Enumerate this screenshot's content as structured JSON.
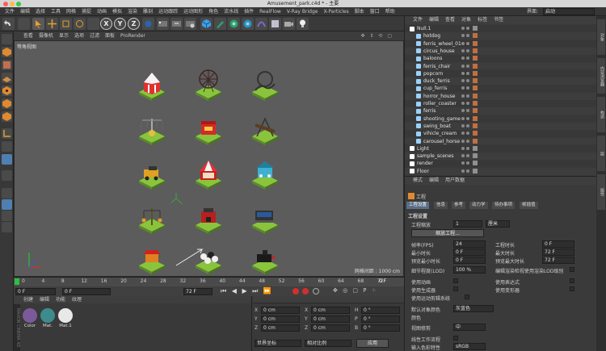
{
  "window": {
    "title": "Amusement_park.c4d * - 主要"
  },
  "menubar": {
    "items": [
      "文件",
      "编辑",
      "选择",
      "工具",
      "网格",
      "捕捉",
      "动画",
      "模拟",
      "渲染",
      "雕刻",
      "运动跟踪",
      "运动图形",
      "角色",
      "流水线",
      "插件",
      "RealFlow",
      "V-Ray Bridge",
      "X-Particles",
      "脚本",
      "窗口",
      "帮助"
    ],
    "interface_label": "界面:",
    "interface_value": "启动"
  },
  "viewport": {
    "menu": [
      "查看",
      "摄像机",
      "显示",
      "选项",
      "过滤",
      "面板",
      "ProRender"
    ],
    "label": "等角视图",
    "grid_info": "网格间距 : 1000 cm"
  },
  "timeline": {
    "ticks": [
      "0",
      "2",
      "4",
      "6",
      "8",
      "10",
      "12",
      "14",
      "16",
      "18",
      "20",
      "22",
      "24",
      "26",
      "28",
      "30",
      "32",
      "34",
      "36",
      "38",
      "40",
      "42",
      "44",
      "46",
      "48",
      "50",
      "52",
      "54",
      "56",
      "58",
      "60",
      "62",
      "64",
      "66",
      "68",
      "70",
      "72"
    ],
    "current": "0 F",
    "start": "0 F",
    "end": "72 F",
    "end2": "72 F",
    "frame_label": "0 F"
  },
  "materials": {
    "menu": [
      "创建",
      "编辑",
      "功能",
      "纹理"
    ],
    "items": [
      {
        "name": "Color",
        "color": "#7a5a9a"
      },
      {
        "name": "Mat.",
        "color": "#3c8c8e"
      },
      {
        "name": "Mat.1",
        "color": "#e8e8e8"
      }
    ]
  },
  "coordinates": {
    "rows": [
      {
        "axis": "X",
        "val": "0 cm",
        "axis2": "X",
        "val2": "0 cm",
        "axis3": "H",
        "val3": "0 °"
      },
      {
        "axis": "Y",
        "val": "0 cm",
        "axis2": "Y",
        "val2": "0 cm",
        "axis3": "P",
        "val3": "0 °"
      },
      {
        "axis": "Z",
        "val": "0 cm",
        "axis2": "Z",
        "val2": "0 cm",
        "axis3": "B",
        "val3": "0 °"
      }
    ],
    "mode": "世界坐标",
    "scale": "相对比例",
    "apply": "应用"
  },
  "objects": {
    "menu": [
      "文件",
      "编辑",
      "查看",
      "对象",
      "标签",
      "书签"
    ],
    "items": [
      {
        "name": "Null.1",
        "indent": 0,
        "color": "#ffffff"
      },
      {
        "name": "hotdog",
        "indent": 1,
        "color": "#9ad1ff"
      },
      {
        "name": "ferris_wheel_01",
        "indent": 1,
        "color": "#9ad1ff"
      },
      {
        "name": "circus_house",
        "indent": 1,
        "color": "#9ad1ff"
      },
      {
        "name": "baloons",
        "indent": 1,
        "color": "#9ad1ff"
      },
      {
        "name": "ferris_chair",
        "indent": 1,
        "color": "#9ad1ff"
      },
      {
        "name": "popcorn",
        "indent": 1,
        "color": "#9ad1ff"
      },
      {
        "name": "duck_ferris",
        "indent": 1,
        "color": "#9ad1ff"
      },
      {
        "name": "cup_ferris",
        "indent": 1,
        "color": "#9ad1ff"
      },
      {
        "name": "horror_house",
        "indent": 1,
        "color": "#9ad1ff"
      },
      {
        "name": "roller_coaster",
        "indent": 1,
        "color": "#9ad1ff"
      },
      {
        "name": "ferris",
        "indent": 1,
        "color": "#9ad1ff"
      },
      {
        "name": "shooting_game",
        "indent": 1,
        "color": "#9ad1ff"
      },
      {
        "name": "swing_boat",
        "indent": 1,
        "color": "#9ad1ff"
      },
      {
        "name": "vihicle_cream",
        "indent": 1,
        "color": "#9ad1ff"
      },
      {
        "name": "carousel_horse",
        "indent": 1,
        "color": "#9ad1ff"
      },
      {
        "name": "Light",
        "indent": 0,
        "color": "#ffffff"
      },
      {
        "name": "sample_scenes",
        "indent": 0,
        "color": "#ffffff"
      },
      {
        "name": "render",
        "indent": 0,
        "color": "#ffffff"
      },
      {
        "name": "Floor",
        "indent": 0,
        "color": "#ffffff"
      }
    ]
  },
  "attributes": {
    "menu": [
      "模式",
      "编辑",
      "用户数据"
    ],
    "section": "工程",
    "tabs": [
      "工程设置",
      "信息",
      "参考",
      "动力学",
      "待办事项",
      "帧插值"
    ],
    "group": "工程设置",
    "scale_label": "工程缩放",
    "scale_val": "1",
    "scale_unit": "厘米",
    "scale_btn": "缩放工程...",
    "fps_label": "帧率(FPS)",
    "fps_val": "24",
    "min_label": "最小时长",
    "min_val": "0 F",
    "premin_label": "预览最小时长",
    "premin_val": "0 F",
    "lod_label": "细节程度(LOD)",
    "lod_val": "100 %",
    "proj_len_label": "工程时长",
    "proj_len_val": "0 F",
    "max_label": "最大时长",
    "max_val": "72 F",
    "premax_label": "预览最大时长",
    "premax_val": "72 F",
    "editlod_label": "编辑渲染检视使用渲染LOD级别",
    "anim_label": "使用动画",
    "expr_label": "使用表达式",
    "gen_label": "使用生成器",
    "deform_label": "使用变形器",
    "motion_label": "使用运动剪辑系统",
    "defcolor_label": "默认对象颜色",
    "defcolor_val": "灰蓝色",
    "color_label": "颜色",
    "clip_label": "视图修剪",
    "clip_val": "中",
    "linear_label": "线性工作流程",
    "input_label": "输入色彩特性",
    "input_val": "sRGB"
  },
  "right_tabs": [
    "对象",
    "内容浏览器",
    "构造",
    "层",
    "属性"
  ]
}
